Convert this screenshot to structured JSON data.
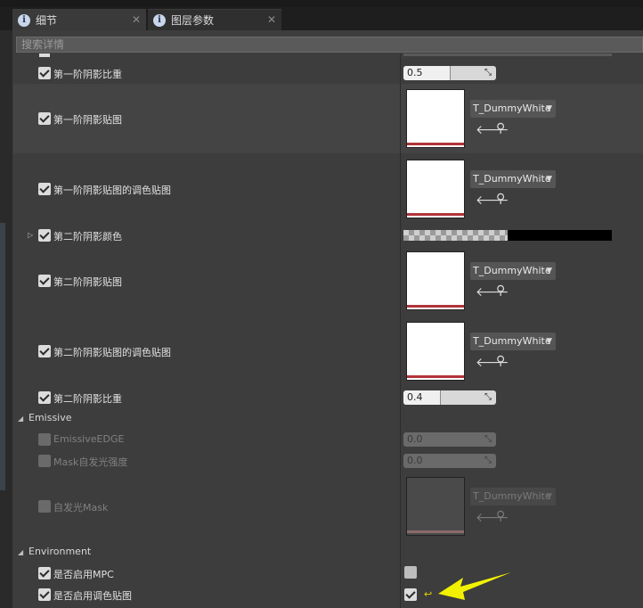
{
  "tabs": [
    {
      "label": "细节",
      "icon": "info-icon",
      "active": true
    },
    {
      "label": "图层参数",
      "icon": "info-icon",
      "active": false
    }
  ],
  "search": {
    "placeholder": "搜索详情"
  },
  "rows": {
    "r1": {
      "label": "第一阶阴影比重",
      "value": "0.5",
      "fill": 0.5
    },
    "r2": {
      "label": "第一阶阴影贴图",
      "texture": "T_DummyWhite"
    },
    "r3": {
      "label": "第一阶阴影贴图的调色贴图",
      "texture": "T_DummyWhite"
    },
    "r4": {
      "label": "第二阶阴影颜色"
    },
    "r5": {
      "label": "第二阶阴影贴图",
      "texture": "T_DummyWhite"
    },
    "r6": {
      "label": "第二阶阴影贴图的调色贴图",
      "texture": "T_DummyWhite"
    },
    "r7": {
      "label": "第二阶阴影比重",
      "value": "0.4",
      "fill": 0.4
    }
  },
  "emissive": {
    "category": "Emissive",
    "edge": {
      "label": "EmissiveEDGE",
      "value": "0.0"
    },
    "strength": {
      "label": "Mask自发光强度",
      "value": "0.0"
    },
    "mask": {
      "label": "自发光Mask",
      "texture": "T_DummyWhite"
    }
  },
  "environment": {
    "category": "Environment",
    "mpc": {
      "label": "是否启用MPC",
      "checked": false
    },
    "tint": {
      "label": "是否启用调色贴图",
      "checked": true
    }
  },
  "colors": {
    "accent_arrow": "#f2f200",
    "texture_bar": "#b0343a"
  }
}
